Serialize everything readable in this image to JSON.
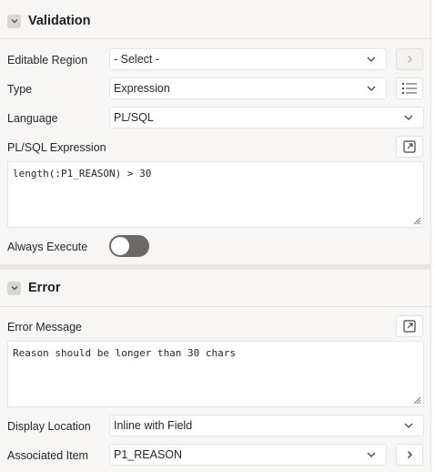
{
  "validation": {
    "title": "Validation",
    "editable_region": {
      "label": "Editable Region",
      "value": "- Select -"
    },
    "type": {
      "label": "Type",
      "value": "Expression"
    },
    "language": {
      "label": "Language",
      "value": "PL/SQL"
    },
    "plsql_expression": {
      "label": "PL/SQL Expression",
      "value": "length(:P1_REASON) > 30"
    },
    "always_execute": {
      "label": "Always Execute",
      "checked": false
    }
  },
  "error": {
    "title": "Error",
    "error_message": {
      "label": "Error Message",
      "value": "Reason should be longer than 30 chars"
    },
    "display_location": {
      "label": "Display Location",
      "value": "Inline with Field"
    },
    "associated_item": {
      "label": "Associated Item",
      "value": "P1_REASON"
    }
  },
  "icons": {
    "collapse": "chevron-down-icon",
    "go_to": "chevron-right-icon",
    "list_of_values": "list-icon",
    "expand_editor": "expand-icon",
    "resize": "resize-handle-icon"
  },
  "colors": {
    "panel_bg": "#f7f6f5",
    "field_bg": "#ffffff",
    "toggle_off": "#6b6866",
    "border": "#e5e3e0"
  }
}
